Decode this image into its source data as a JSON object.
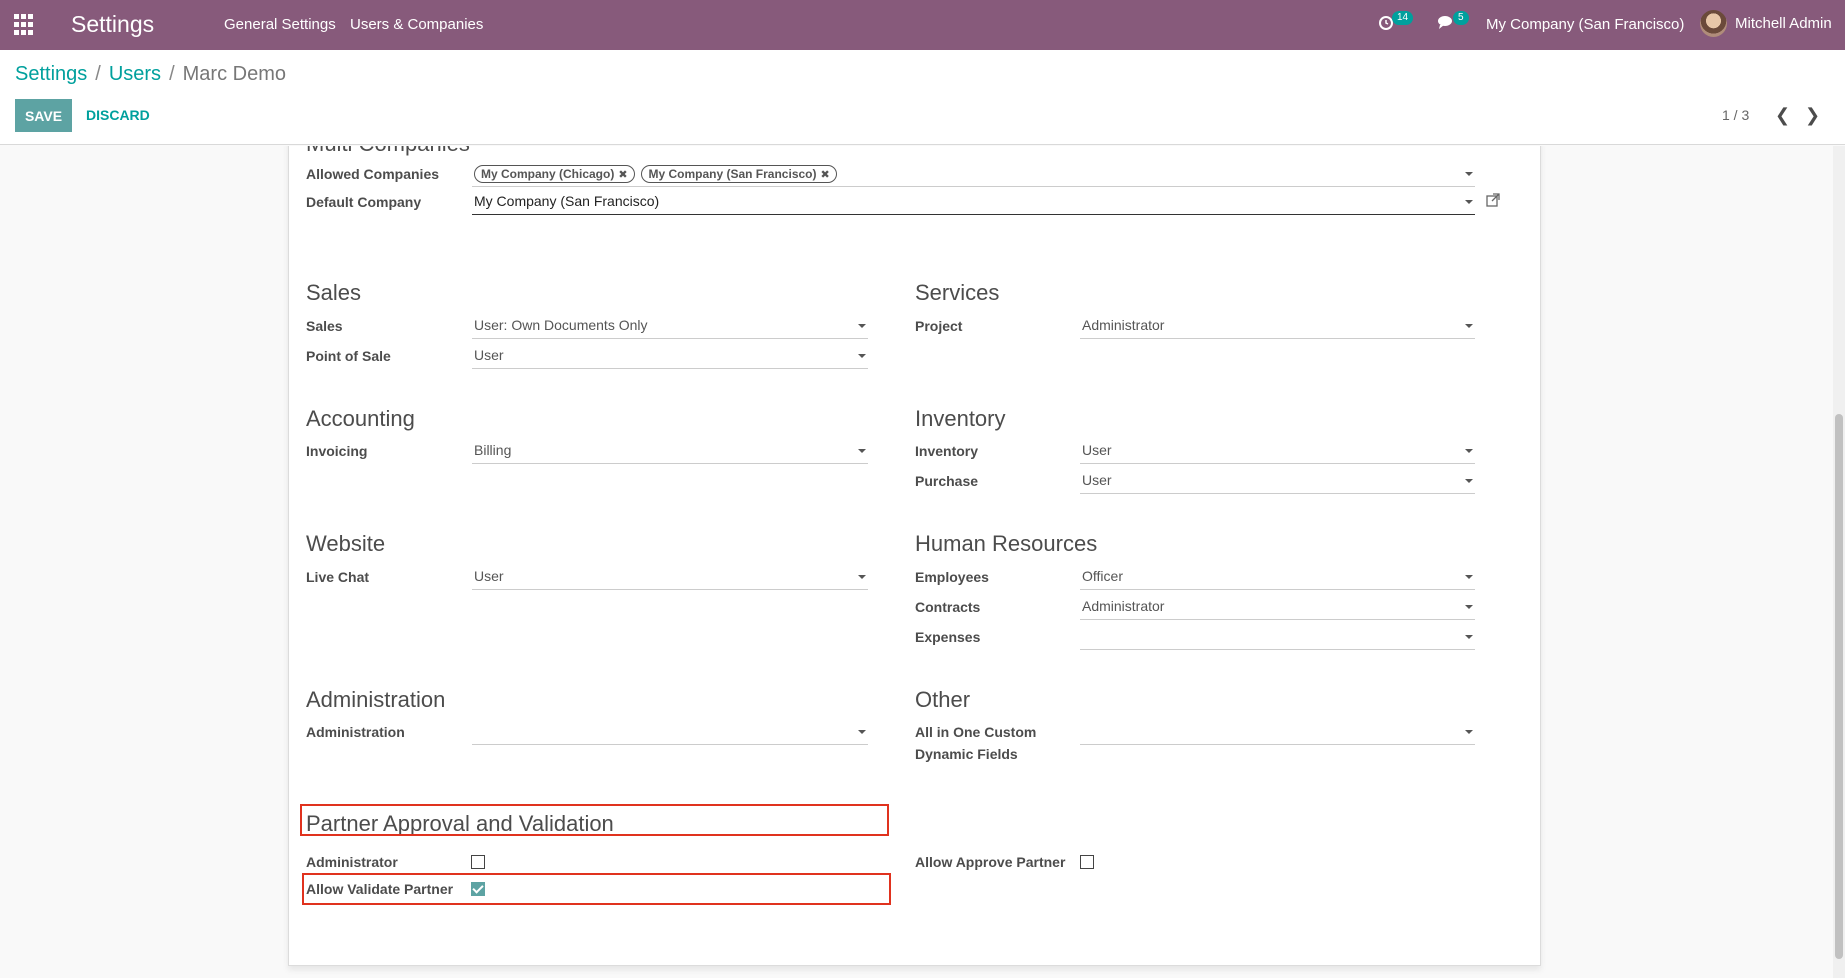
{
  "nav": {
    "app_title": "Settings",
    "menu": [
      "General Settings",
      "Users & Companies"
    ],
    "activity_badge": "14",
    "messages_badge": "5",
    "company": "My Company (San Francisco)",
    "user": "Mitchell Admin"
  },
  "breadcrumb": {
    "settings": "Settings",
    "users": "Users",
    "current": "Marc Demo",
    "sep": "/"
  },
  "actions": {
    "save": "SAVE",
    "discard": "DISCARD"
  },
  "pager": {
    "value": "1 / 3"
  },
  "multi_companies": {
    "title": "Multi Companies",
    "allowed_label": "Allowed Companies",
    "allowed_tags": [
      "My Company (Chicago)",
      "My Company (San Francisco)"
    ],
    "default_label": "Default Company",
    "default_value": "My Company (San Francisco)"
  },
  "groups": {
    "sales": {
      "title": "Sales",
      "fields": [
        {
          "label": "Sales",
          "value": "User: Own Documents Only"
        },
        {
          "label": "Point of Sale",
          "value": "User"
        }
      ]
    },
    "services": {
      "title": "Services",
      "fields": [
        {
          "label": "Project",
          "value": "Administrator"
        }
      ]
    },
    "accounting": {
      "title": "Accounting",
      "fields": [
        {
          "label": "Invoicing",
          "value": "Billing"
        }
      ]
    },
    "inventory": {
      "title": "Inventory",
      "fields": [
        {
          "label": "Inventory",
          "value": "User"
        },
        {
          "label": "Purchase",
          "value": "User"
        }
      ]
    },
    "website": {
      "title": "Website",
      "fields": [
        {
          "label": "Live Chat",
          "value": "User"
        }
      ]
    },
    "hr": {
      "title": "Human Resources",
      "fields": [
        {
          "label": "Employees",
          "value": "Officer"
        },
        {
          "label": "Contracts",
          "value": "Administrator"
        },
        {
          "label": "Expenses",
          "value": ""
        }
      ]
    },
    "administration": {
      "title": "Administration",
      "fields": [
        {
          "label": "Administration",
          "value": ""
        }
      ]
    },
    "other": {
      "title": "Other",
      "fields": [
        {
          "label": "All in One Custom Dynamic Fields",
          "value": ""
        }
      ]
    },
    "partner": {
      "title": "Partner Approval and Validation",
      "administrator_label": "Administrator",
      "administrator_checked": false,
      "allow_validate_label": "Allow Validate Partner",
      "allow_validate_checked": true,
      "allow_approve_label": "Allow Approve Partner",
      "allow_approve_checked": false
    }
  },
  "colors": {
    "navbar": "#875a7b",
    "accent": "#00a09d",
    "highlight": "#e0321e"
  }
}
